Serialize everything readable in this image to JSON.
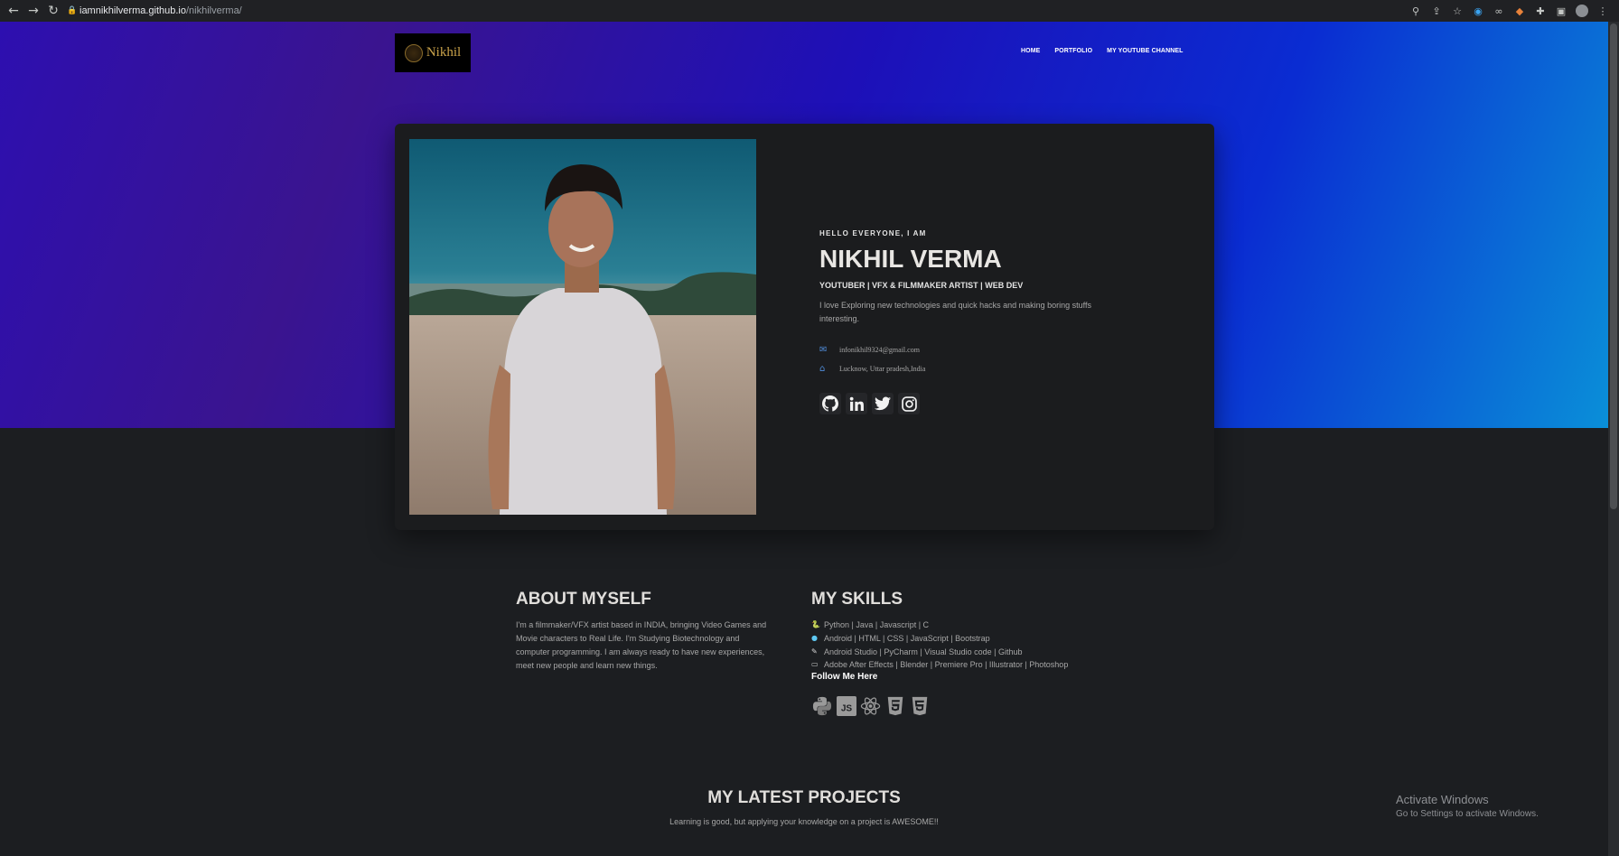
{
  "browser": {
    "url_host": "iamnikhilverma.github.io",
    "url_path": "/nikhilverma/"
  },
  "header": {
    "logo_text": "Nikhil",
    "nav": [
      "HOME",
      "PORTFOLIO",
      "MY YOUTUBE CHANNEL"
    ]
  },
  "profile": {
    "greeting": "HELLO EVERYONE, I AM",
    "name": "NIKHIL VERMA",
    "tagline": "YOUTUBER | VFX & FILMMAKER ARTIST | WEB DEV",
    "bio": "I love Exploring new technologies and quick hacks and making boring stuffs interesting.",
    "email": "infonikhil9324@gmail.com",
    "location": "Lucknow, Uttar pradesh,India",
    "socials": [
      "github-icon",
      "linkedin-icon",
      "twitter-icon",
      "instagram-icon"
    ]
  },
  "about": {
    "heading": "ABOUT MYSELF",
    "text": "I'm a filmmaker/VFX artist based in INDIA, bringing Video Games and Movie characters to Real Life. I'm Studying Biotechnology and computer programming. I am always ready to have new experiences, meet new people and learn new things."
  },
  "skills": {
    "heading": "MY SKILLS",
    "items": [
      "Python | Java | Javascript | C",
      "Android | HTML | CSS | JavaScript | Bootstrap",
      "Android Studio | PyCharm | Visual Studio code | Github",
      "Adobe After Effects | Blender | Premiere Pro | Illustrator | Photoshop"
    ],
    "follow_label": "Follow Me Here",
    "tech_icons": [
      "python-icon",
      "javascript-icon",
      "react-icon",
      "css3-icon",
      "html5-icon"
    ]
  },
  "projects": {
    "heading": "MY LATEST PROJECTS",
    "subtitle": "Learning is good, but applying your knowledge on a project is AWESOME!!"
  },
  "os_watermark": {
    "line1": "Activate Windows",
    "line2": "Go to Settings to activate Windows."
  }
}
